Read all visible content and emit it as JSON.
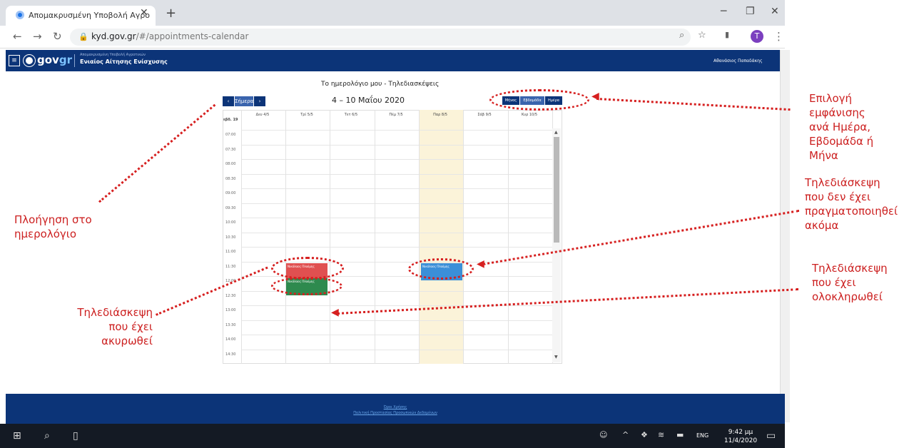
{
  "browser": {
    "tab_title": "Απομακρυσμένη Υποβολή Αγρο",
    "url_host": "kyd.gov.gr",
    "url_path": "/#/appointments-calendar",
    "avatar_initial": "T"
  },
  "header": {
    "brand_main": "gov",
    "brand_accent": "gr",
    "subtitle_small": "Απομακρυσμένη Υποβολή Αγροτικών",
    "subtitle": "Ενιαίος Αίτησης Ενίσχυσης",
    "user_name": "Αθανάσιος Παπαδάκης"
  },
  "calendar": {
    "page_title": "Το ημερολόγιο μου - Τηλεδιασκέψεις",
    "week_title": "4 – 10 Μαΐου 2020",
    "nav": {
      "prev": "‹",
      "today": "Σήμερα",
      "next": "›"
    },
    "views": {
      "month": "Μήνας",
      "week": "Εβδομάδα",
      "day": "Ημέρα"
    },
    "week_number": "εβδ. 19",
    "days": [
      "Δευ 4/5",
      "Τρί 5/5",
      "Τετ 6/5",
      "Πέμ 7/5",
      "Παρ 8/5",
      "Σάβ 9/5",
      "Κυρ 10/5"
    ],
    "times": [
      "07:00",
      "07:30",
      "08:00",
      "08:30",
      "09:00",
      "09:30",
      "10:00",
      "10:30",
      "11:00",
      "11:30",
      "12:00",
      "12:30",
      "13:00",
      "13:30",
      "14:00",
      "14:30"
    ],
    "events": {
      "cancelled": "Νικόλαος Πλούμης",
      "completed": "Νικόλαος Πλούμης",
      "pending": "Νικόλαος Πλούμης"
    }
  },
  "annotations": {
    "views": [
      "Επιλογή",
      "εμφάνισης",
      "ανά Ημέρα,",
      "Εβδομάδα ή",
      "Μήνα"
    ],
    "nav": [
      "Πλοήγηση στο",
      "ημερολόγιο"
    ],
    "pending": [
      "Τηλεδιάσκεψη",
      "που δεν έχει",
      "πραγματοποιηθεί",
      "ακόμα"
    ],
    "completed": [
      "Τηλεδιάσκεψη",
      "που έχει",
      "ολοκληρωθεί"
    ],
    "cancelled": [
      "Τηλεδιάσκεψη",
      "που έχει",
      "ακυρωθεί"
    ]
  },
  "footer": {
    "link1": "Όροι Χρήσης",
    "link2": "Πολιτική Προστασίας Προσωπικών Δεδομένων"
  },
  "taskbar": {
    "lang": "ENG",
    "time": "9:42 μμ",
    "date": "11/4/2020"
  },
  "colors": {
    "navy": "#0c3478",
    "annotation_red": "#cc1f1f",
    "cancelled": "#e05050",
    "completed": "#2e8a4e",
    "pending": "#3b8fd8",
    "today_bg": "#fbf3d9"
  }
}
